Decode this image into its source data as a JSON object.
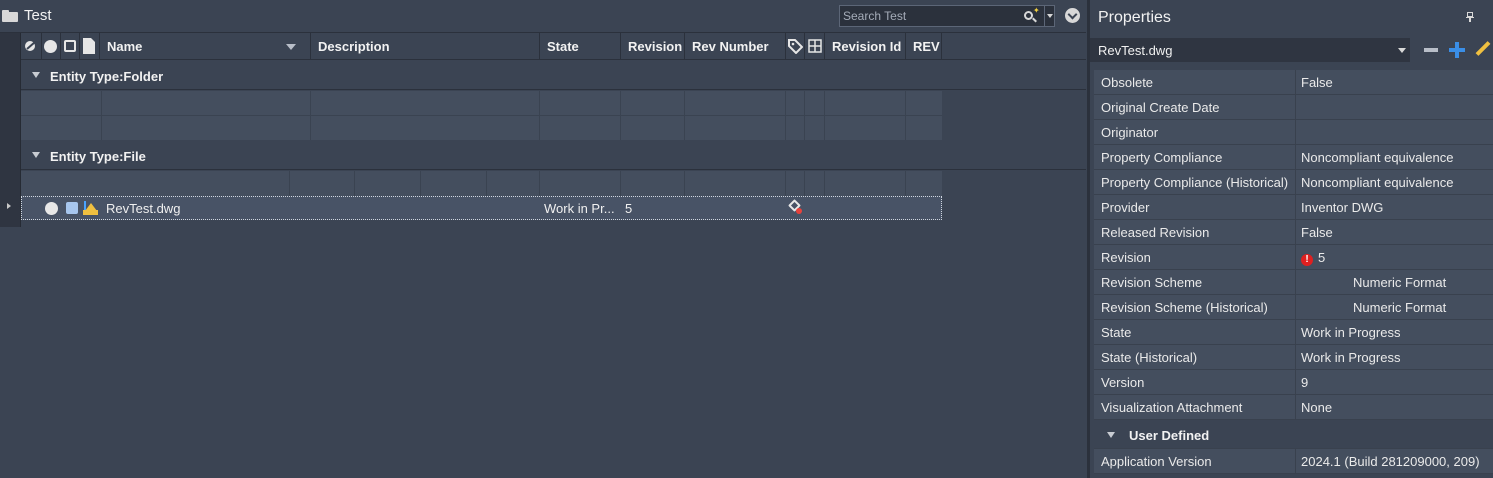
{
  "window": {
    "title": "Test",
    "search_placeholder": "Search Test"
  },
  "grid": {
    "columns": [
      "Name",
      "Description",
      "State",
      "Revision",
      "Rev Number",
      "Revision Id",
      "REV"
    ],
    "groups": [
      {
        "label": "Entity Type:Folder"
      },
      {
        "label": "Entity Type:File"
      }
    ],
    "rows": [
      {
        "name": "RevTest.dwg",
        "state": "Work in Pr...",
        "revision": "5"
      }
    ]
  },
  "properties": {
    "title": "Properties",
    "selected_item": "RevTest.dwg",
    "rows": [
      {
        "key": "Obsolete",
        "value": "False"
      },
      {
        "key": "Original Create Date",
        "value": ""
      },
      {
        "key": "Originator",
        "value": ""
      },
      {
        "key": "Property Compliance",
        "value": "Noncompliant equivalence"
      },
      {
        "key": "Property Compliance (Historical)",
        "value": "Noncompliant equivalence"
      },
      {
        "key": "Provider",
        "value": "Inventor DWG"
      },
      {
        "key": "Released Revision",
        "value": "False"
      },
      {
        "key": "Revision",
        "value": "5"
      },
      {
        "key": "Revision Scheme",
        "value": "Numeric Format"
      },
      {
        "key": "Revision Scheme (Historical)",
        "value": "Numeric Format"
      },
      {
        "key": "State",
        "value": "Work in Progress"
      },
      {
        "key": "State (Historical)",
        "value": "Work in Progress"
      },
      {
        "key": "Version",
        "value": "9"
      },
      {
        "key": "Visualization Attachment",
        "value": "None"
      }
    ],
    "user_defined_group": "User Defined",
    "user_defined_rows": [
      {
        "key": "Application Version",
        "value": "2024.1 (Build 281209000, 209)"
      }
    ]
  },
  "colors": {
    "background": "#3b4453",
    "accent_blue": "#3a8ee6",
    "warning_red": "#e02020"
  }
}
